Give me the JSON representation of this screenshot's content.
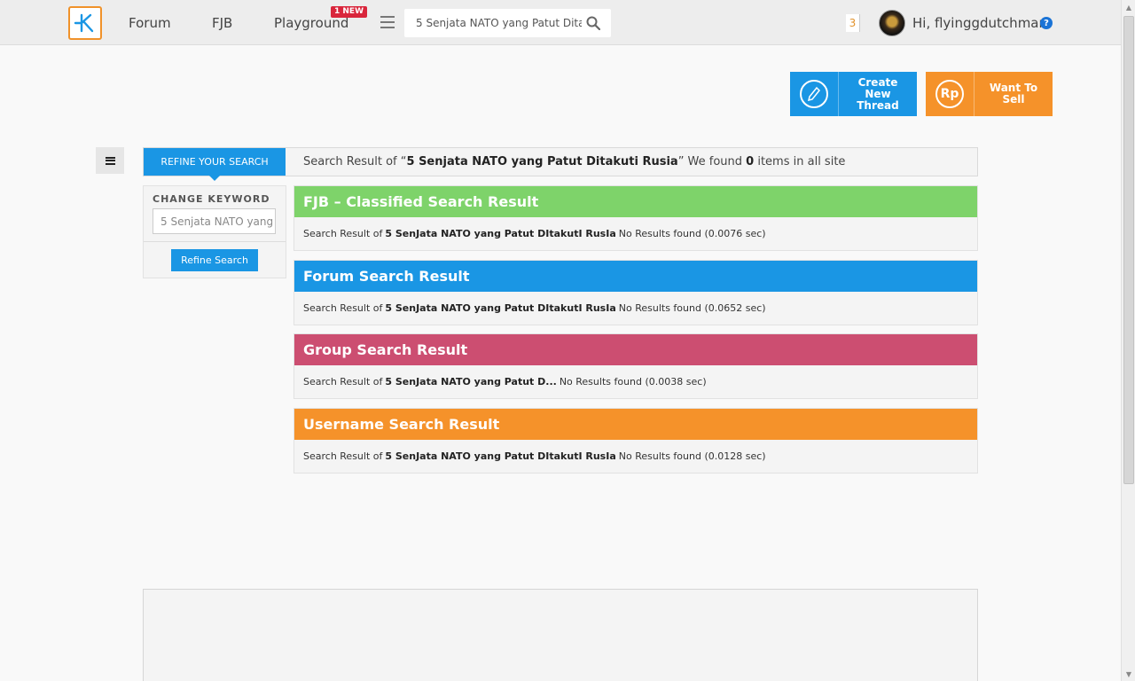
{
  "nav": {
    "links": [
      "Forum",
      "FJB",
      "Playground"
    ],
    "new_badge": "1 NEW",
    "search_value": "5 Senjata NATO yang Patut Dita",
    "notification_count": "3",
    "greeting": "Hi, flyinggdutchman",
    "help": "?"
  },
  "actions": {
    "create_thread": "Create New Thread",
    "want_to_sell": "Want To Sell",
    "sell_icon_text": "Rp"
  },
  "summary": {
    "tab_label": "REFINE YOUR SEARCH",
    "prefix": "Search Result of “",
    "keyword": "5 Senjata NATO yang Patut Ditakuti Rusia",
    "middle": "” We found ",
    "count": "0",
    "suffix": " items in all site"
  },
  "refine": {
    "heading": "CHANGE KEYWORD",
    "input_value": "5 Senjata NATO yang",
    "button": "Refine Search"
  },
  "results": [
    {
      "title": "FJB – Classified Search Result",
      "prefix": "Search Result of",
      "keyword": "5 SenJata NATO yang Patut DItakutI RusIa",
      "status": " No Results found (0.0076 sec)"
    },
    {
      "title": "Forum Search Result",
      "prefix": "Search Result of",
      "keyword": "5 SenJata NATO yang Patut DItakutI RusIa",
      "status": "No Results found (0.0652 sec)"
    },
    {
      "title": "Group Search Result",
      "prefix": "Search Result of",
      "keyword": "5 SenJata NATO yang Patut D...",
      "status": "No Results found (0.0038 sec)"
    },
    {
      "title": "Username Search Result",
      "prefix": "Search Result of",
      "keyword": "5 SenJata NATO yang Patut DItakutI RusIa",
      "status": "No Results found (0.0128 sec)"
    }
  ],
  "colors": {
    "brand_blue": "#1a96e4",
    "fjb_green": "#7ed36a",
    "group_pink": "#cc4e71",
    "orange": "#f5922a"
  }
}
